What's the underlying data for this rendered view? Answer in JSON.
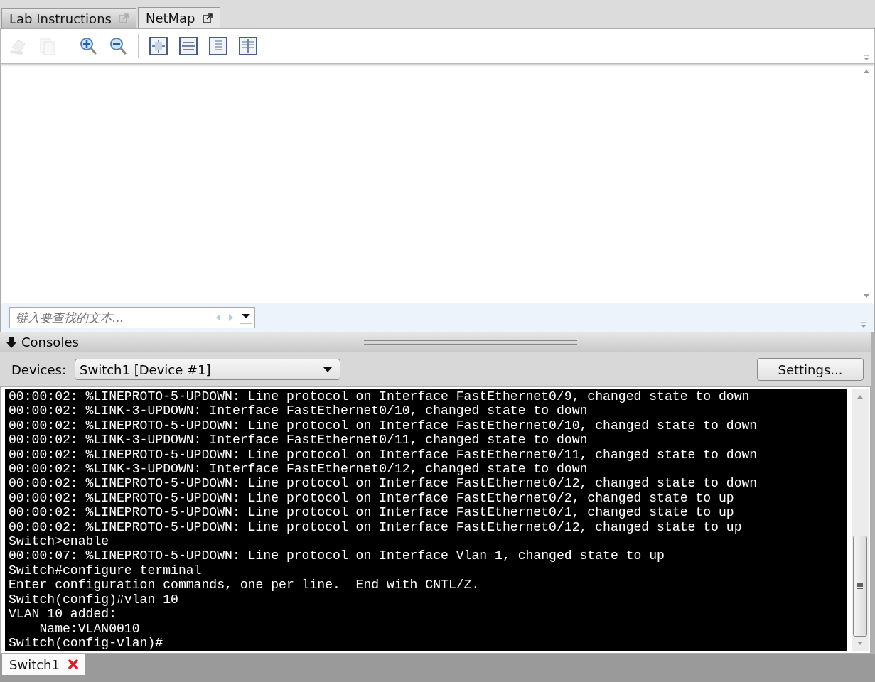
{
  "tabs": [
    {
      "label": "Lab Instructions",
      "selected": false
    },
    {
      "label": "NetMap",
      "selected": true
    }
  ],
  "toolbar": [
    {
      "kind": "print",
      "disabled": true
    },
    {
      "kind": "copy",
      "disabled": true
    },
    {
      "kind": "sep"
    },
    {
      "kind": "zoom-in",
      "disabled": false
    },
    {
      "kind": "zoom-out",
      "disabled": false
    },
    {
      "kind": "sep"
    },
    {
      "kind": "fit-page",
      "disabled": false
    },
    {
      "kind": "fit-width",
      "disabled": false
    },
    {
      "kind": "single-page",
      "disabled": false
    },
    {
      "kind": "two-page",
      "disabled": false
    }
  ],
  "find": {
    "placeholder": "键入要查找的文本..."
  },
  "consoles": {
    "title": "Consoles",
    "devices_label": "Devices:",
    "device": "Switch1 [Device #1]",
    "settings": "Settings..."
  },
  "terminal": {
    "lines": [
      "00:00:02: %LINEPROTO-5-UPDOWN: Line protocol on Interface FastEthernet0/9, changed state to down",
      "00:00:02: %LINK-3-UPDOWN: Interface FastEthernet0/10, changed state to down",
      "00:00:02: %LINEPROTO-5-UPDOWN: Line protocol on Interface FastEthernet0/10, changed state to down",
      "00:00:02: %LINK-3-UPDOWN: Interface FastEthernet0/11, changed state to down",
      "00:00:02: %LINEPROTO-5-UPDOWN: Line protocol on Interface FastEthernet0/11, changed state to down",
      "00:00:02: %LINK-3-UPDOWN: Interface FastEthernet0/12, changed state to down",
      "00:00:02: %LINEPROTO-5-UPDOWN: Line protocol on Interface FastEthernet0/12, changed state to down",
      "00:00:02: %LINEPROTO-5-UPDOWN: Line protocol on Interface FastEthernet0/2, changed state to up",
      "00:00:02: %LINEPROTO-5-UPDOWN: Line protocol on Interface FastEthernet0/1, changed state to up",
      "00:00:02: %LINEPROTO-5-UPDOWN: Line protocol on Interface FastEthernet0/12, changed state to up",
      "Switch>enable",
      "00:00:07: %LINEPROTO-5-UPDOWN: Line protocol on Interface Vlan 1, changed state to up",
      "Switch#configure terminal",
      "Enter configuration commands, one per line.  End with CNTL/Z.",
      "Switch(config)#vlan 10",
      "VLAN 10 added:",
      "    Name:VLAN0010",
      "Switch(config-vlan)#"
    ]
  },
  "bottom_tabs": [
    {
      "label": "Switch1",
      "selected": true
    }
  ]
}
